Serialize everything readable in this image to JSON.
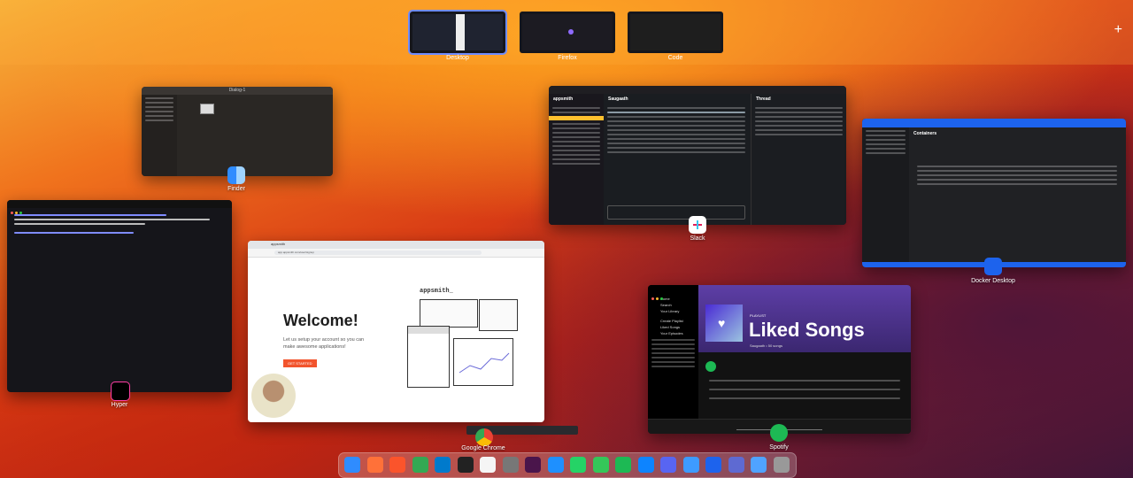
{
  "spaces": [
    {
      "label": "Desktop",
      "active": true
    },
    {
      "label": "Firefox",
      "active": false
    },
    {
      "label": "Code",
      "active": false
    }
  ],
  "add_space_label": "+",
  "windows": {
    "finder": {
      "label": "Finder",
      "title": "Dialog-1"
    },
    "slack": {
      "label": "Slack",
      "workspace": "appsmith",
      "channel": "Saugaath",
      "thread_title": "Thread"
    },
    "docker": {
      "label": "Docker Desktop",
      "section": "Containers"
    },
    "hyper": {
      "label": "Hyper"
    },
    "chrome": {
      "label": "Google Chrome",
      "tab": "appsmith",
      "url": "app.appsmith.com/user/signup",
      "brand": "appsmith_",
      "heading": "Welcome!",
      "subtext": "Let us setup your account so you can make awesome applications!",
      "button": "GET STARTED"
    },
    "spotify": {
      "label": "Spotify",
      "playlist_type": "PLAYLIST",
      "title": "Liked Songs",
      "meta": "Saugaath • 50 songs",
      "nav": [
        "Home",
        "Search",
        "Your Library",
        "Create Playlist",
        "Liked Songs",
        "Your Episodes"
      ]
    }
  },
  "colors": {
    "accent": "#6f8cff",
    "spotify_green": "#1db954",
    "spotify_purple": "#5d3ea6",
    "docker_blue": "#1d63ed",
    "slack_sidebar": "#1a1d21",
    "appsmith_orange": "#f2542d"
  },
  "dock": [
    "finder-icon",
    "firefox-icon",
    "brave-icon",
    "chrome-icon",
    "vscode-icon",
    "terminal-icon",
    "notion-icon",
    "calculator-icon",
    "slack-icon",
    "safari-icon",
    "whatsapp-icon",
    "phone-icon",
    "spotify-icon",
    "appstore-icon",
    "discord-icon",
    "finder-alt-icon",
    "docker-icon",
    "linear-icon",
    "folder-icon",
    "trash-icon"
  ]
}
